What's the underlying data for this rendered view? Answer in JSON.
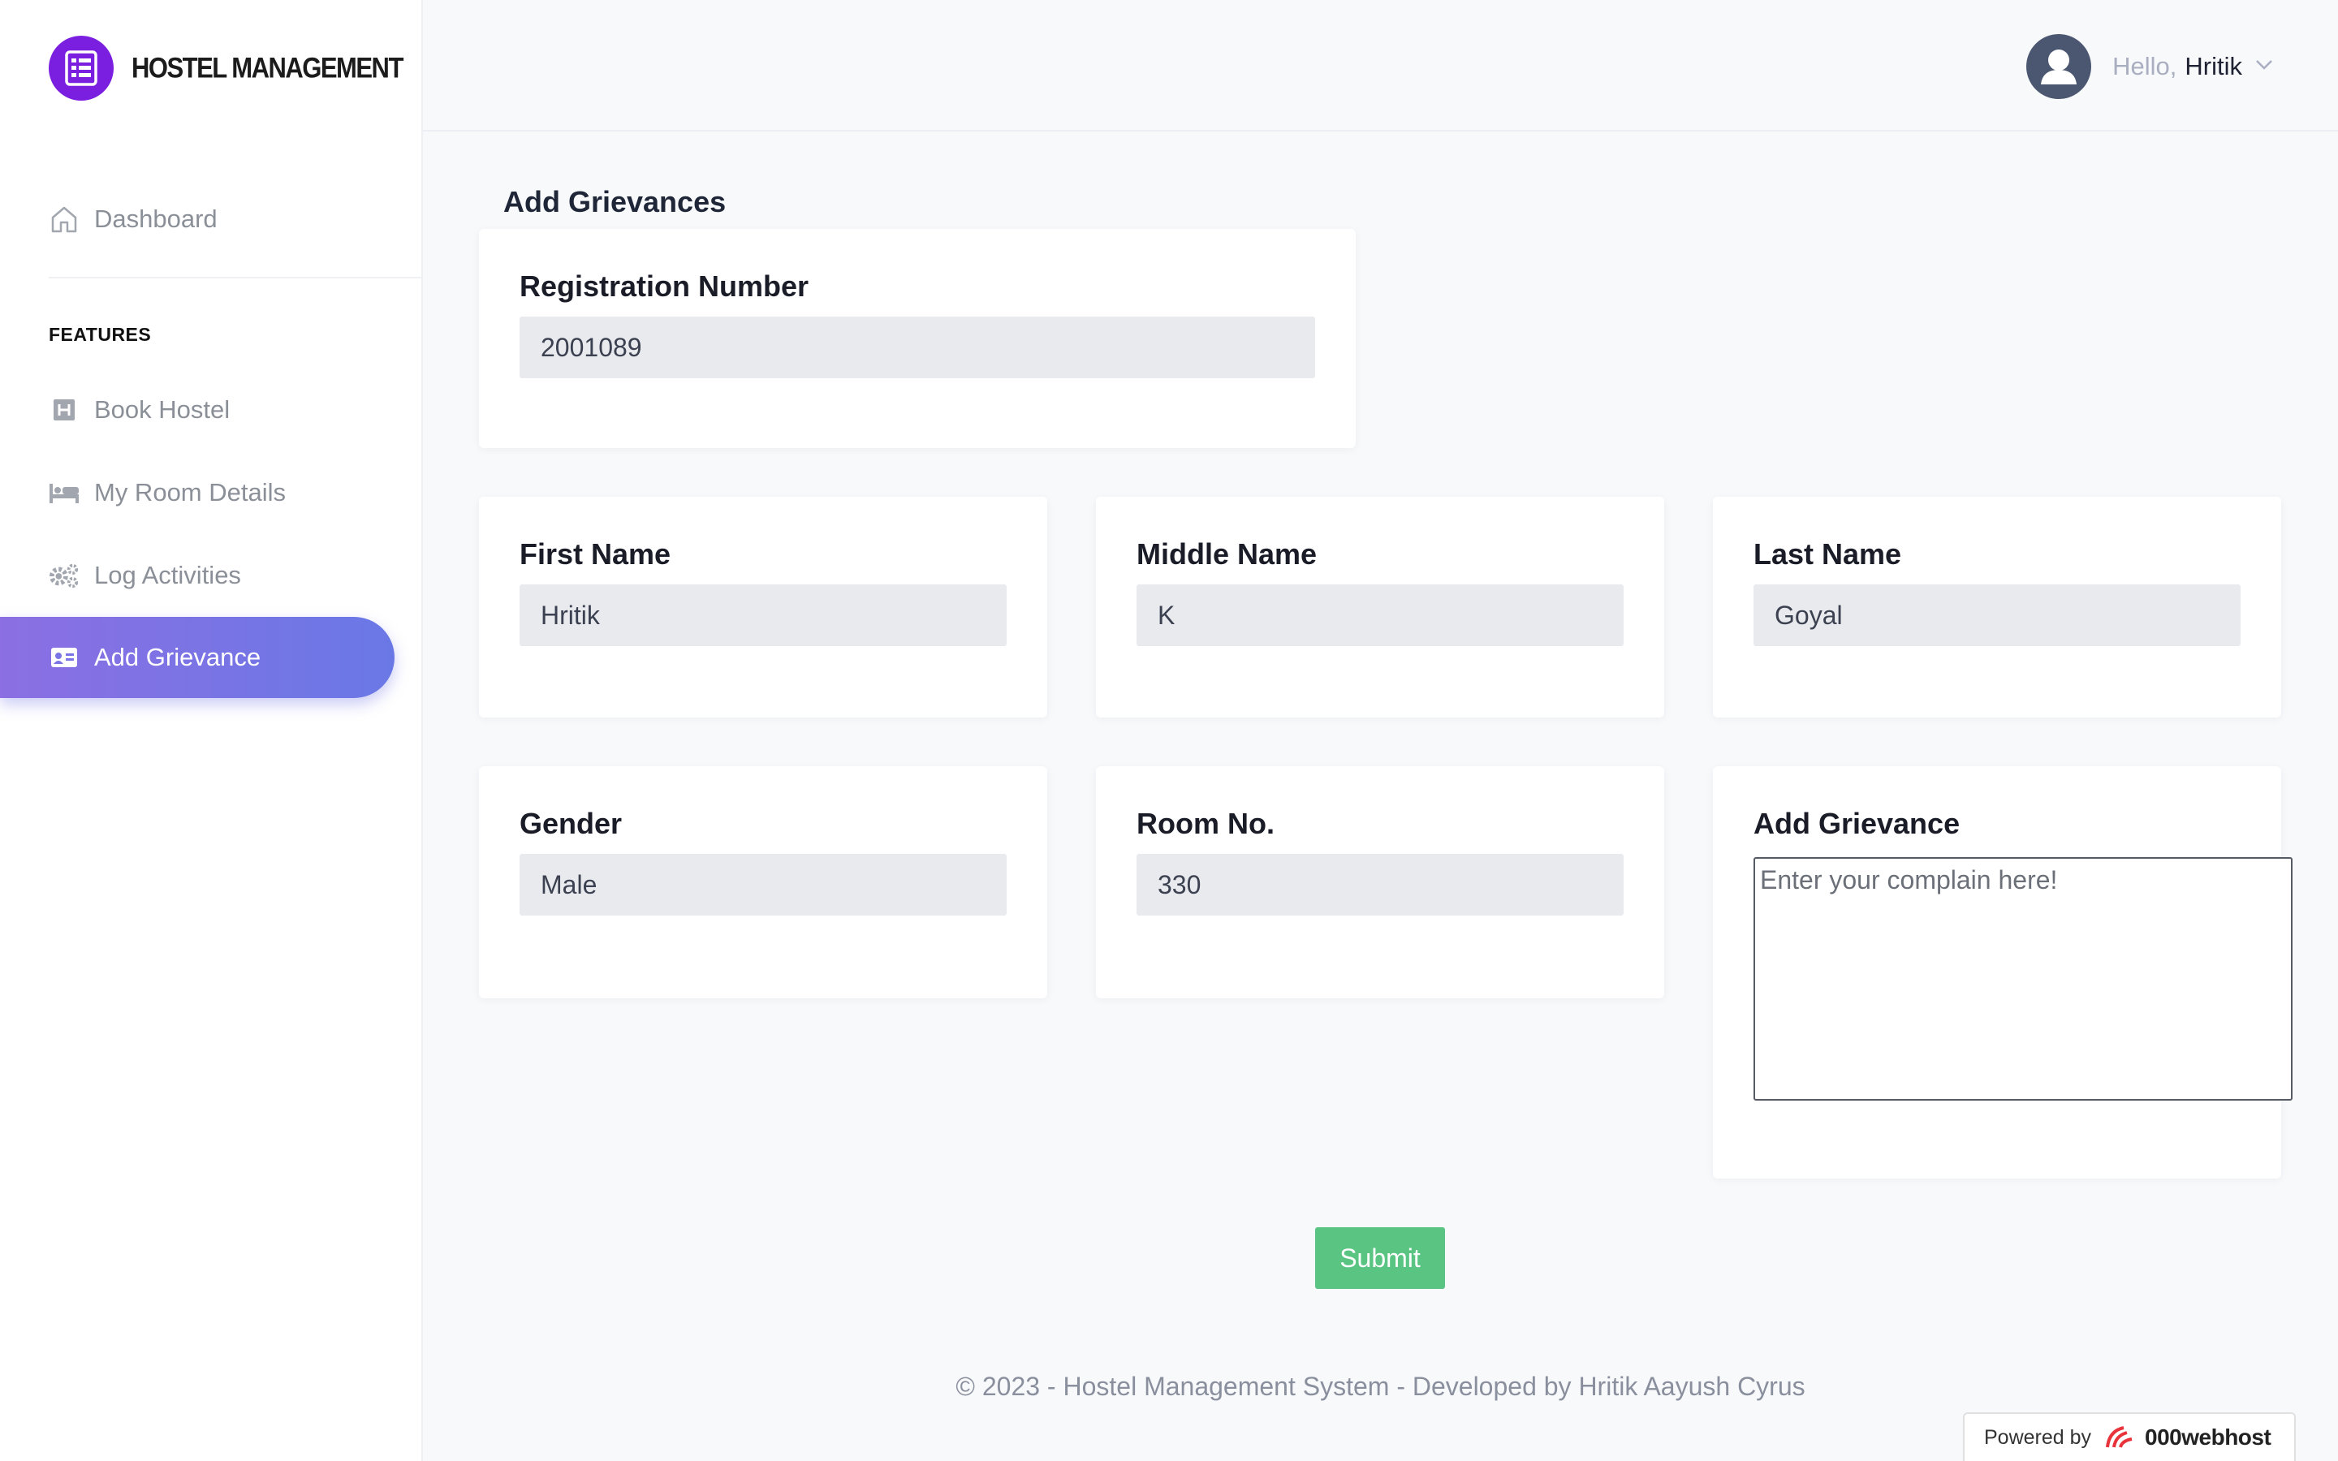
{
  "brand": {
    "name": "HOSTEL MANAGEMENT",
    "logo_icon": "building-list-icon",
    "logo_color": "#7a1fe0"
  },
  "sidebar": {
    "dashboard": {
      "label": "Dashboard",
      "icon": "home-icon"
    },
    "section_label": "FEATURES",
    "items": [
      {
        "label": "Book Hostel",
        "icon": "hotel-icon"
      },
      {
        "label": "My Room Details",
        "icon": "bed-icon"
      },
      {
        "label": "Log Activities",
        "icon": "cogs-icon"
      },
      {
        "label": "Add Grievance",
        "icon": "id-card-icon",
        "active": true
      }
    ],
    "active_gradient": [
      "#8b6fe3",
      "#6a78e6"
    ]
  },
  "header": {
    "greeting": "Hello,",
    "user_name": "Hritik",
    "avatar_icon": "user-avatar-icon",
    "dropdown_icon": "chevron-down-icon"
  },
  "page": {
    "title": "Add Grievances",
    "fields": {
      "registration_number": {
        "label": "Registration Number",
        "value": "2001089"
      },
      "first_name": {
        "label": "First Name",
        "value": "Hritik"
      },
      "middle_name": {
        "label": "Middle Name",
        "value": "K"
      },
      "last_name": {
        "label": "Last Name",
        "value": "Goyal"
      },
      "gender": {
        "label": "Gender",
        "value": "Male"
      },
      "room_no": {
        "label": "Room No.",
        "value": "330"
      },
      "grievance": {
        "label": "Add Grievance",
        "placeholder": "Enter your complain here!",
        "value": ""
      }
    },
    "submit_label": "Submit",
    "submit_color": "#5ac582"
  },
  "footer": {
    "text": "© 2023 - Hostel Management System - Developed by Hritik Aayush Cyrus"
  },
  "powered_by": {
    "prefix": "Powered by",
    "brand": "000webhost"
  }
}
